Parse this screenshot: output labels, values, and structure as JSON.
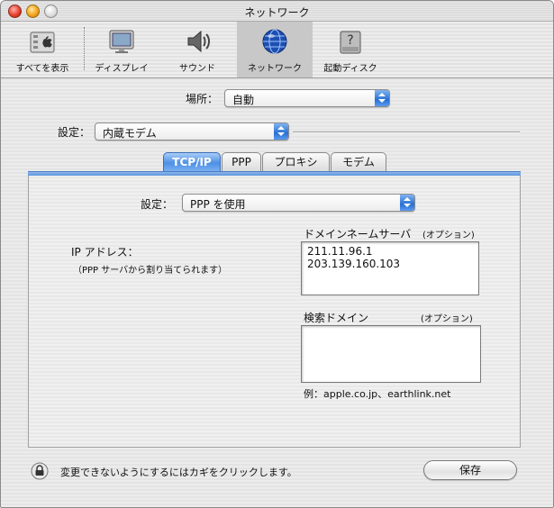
{
  "window": {
    "title": "ネットワーク"
  },
  "toolbar": {
    "items": [
      {
        "label": "すべてを表示",
        "icon": "apple-prefs-icon"
      },
      {
        "label": "ディスプレイ",
        "icon": "display-icon"
      },
      {
        "label": "サウンド",
        "icon": "speaker-icon"
      },
      {
        "label": "ネットワーク",
        "icon": "globe-icon",
        "selected": true
      },
      {
        "label": "起動ディスク",
        "icon": "hard-disk-icon"
      }
    ]
  },
  "location": {
    "label": "場所：",
    "value": "自動"
  },
  "config": {
    "label": "設定：",
    "value": "内蔵モデム"
  },
  "tabs": [
    {
      "label": "TCP/IP",
      "active": true
    },
    {
      "label": "PPP",
      "active": false
    },
    {
      "label": "プロキシ",
      "active": false
    },
    {
      "label": "モデム",
      "active": false
    }
  ],
  "tcpip": {
    "config_label": "設定：",
    "config_value": "PPP を使用",
    "ip_label": "IP アドレス：",
    "ip_note": "（PPP サーバから割り当てられます）",
    "dns_label": "ドメインネームサーバ",
    "dns_optional": "(オプション)",
    "dns_servers": [
      "211.11.96.1",
      "203.139.160.103"
    ],
    "search_label": "検索ドメイン",
    "search_optional": "(オプション)",
    "example": "例：apple.co.jp、earthlink.net"
  },
  "footer": {
    "lock_text": "変更できないようにするにはカギをクリックします。",
    "save_label": "保存"
  },
  "colors": {
    "accent": "#2a6fd4",
    "tab_active": "#4e90e6"
  }
}
